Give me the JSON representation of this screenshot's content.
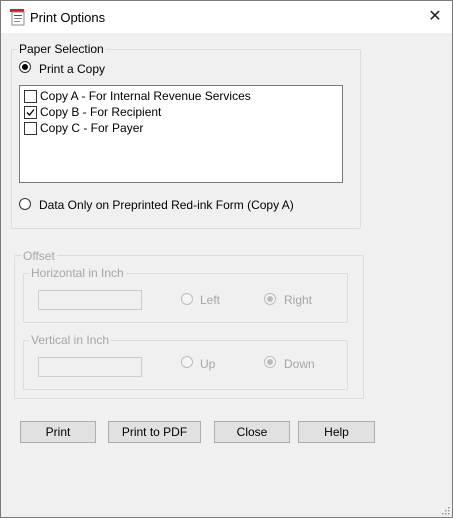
{
  "window": {
    "title": "Print Options",
    "close_glyph": "✕"
  },
  "paper_selection": {
    "legend": "Paper Selection",
    "print_copy_label": "Print a Copy",
    "print_copy_checked": true,
    "copies": [
      {
        "label": "Copy A - For Internal Revenue Services",
        "checked": false
      },
      {
        "label": "Copy B - For Recipient",
        "checked": true
      },
      {
        "label": "Copy C - For Payer",
        "checked": false
      }
    ],
    "data_only_label": "Data Only on Preprinted Red-ink Form (Copy A)",
    "data_only_checked": false
  },
  "offset": {
    "legend": "Offset",
    "enabled": false,
    "horizontal": {
      "legend": "Horizontal in Inch",
      "value": "",
      "left_label": "Left",
      "right_label": "Right",
      "selected": "Right"
    },
    "vertical": {
      "legend": "Vertical in Inch",
      "value": "",
      "up_label": "Up",
      "down_label": "Down",
      "selected": "Down"
    }
  },
  "buttons": {
    "print": "Print",
    "print_pdf": "Print to PDF",
    "close": "Close",
    "help": "Help"
  }
}
